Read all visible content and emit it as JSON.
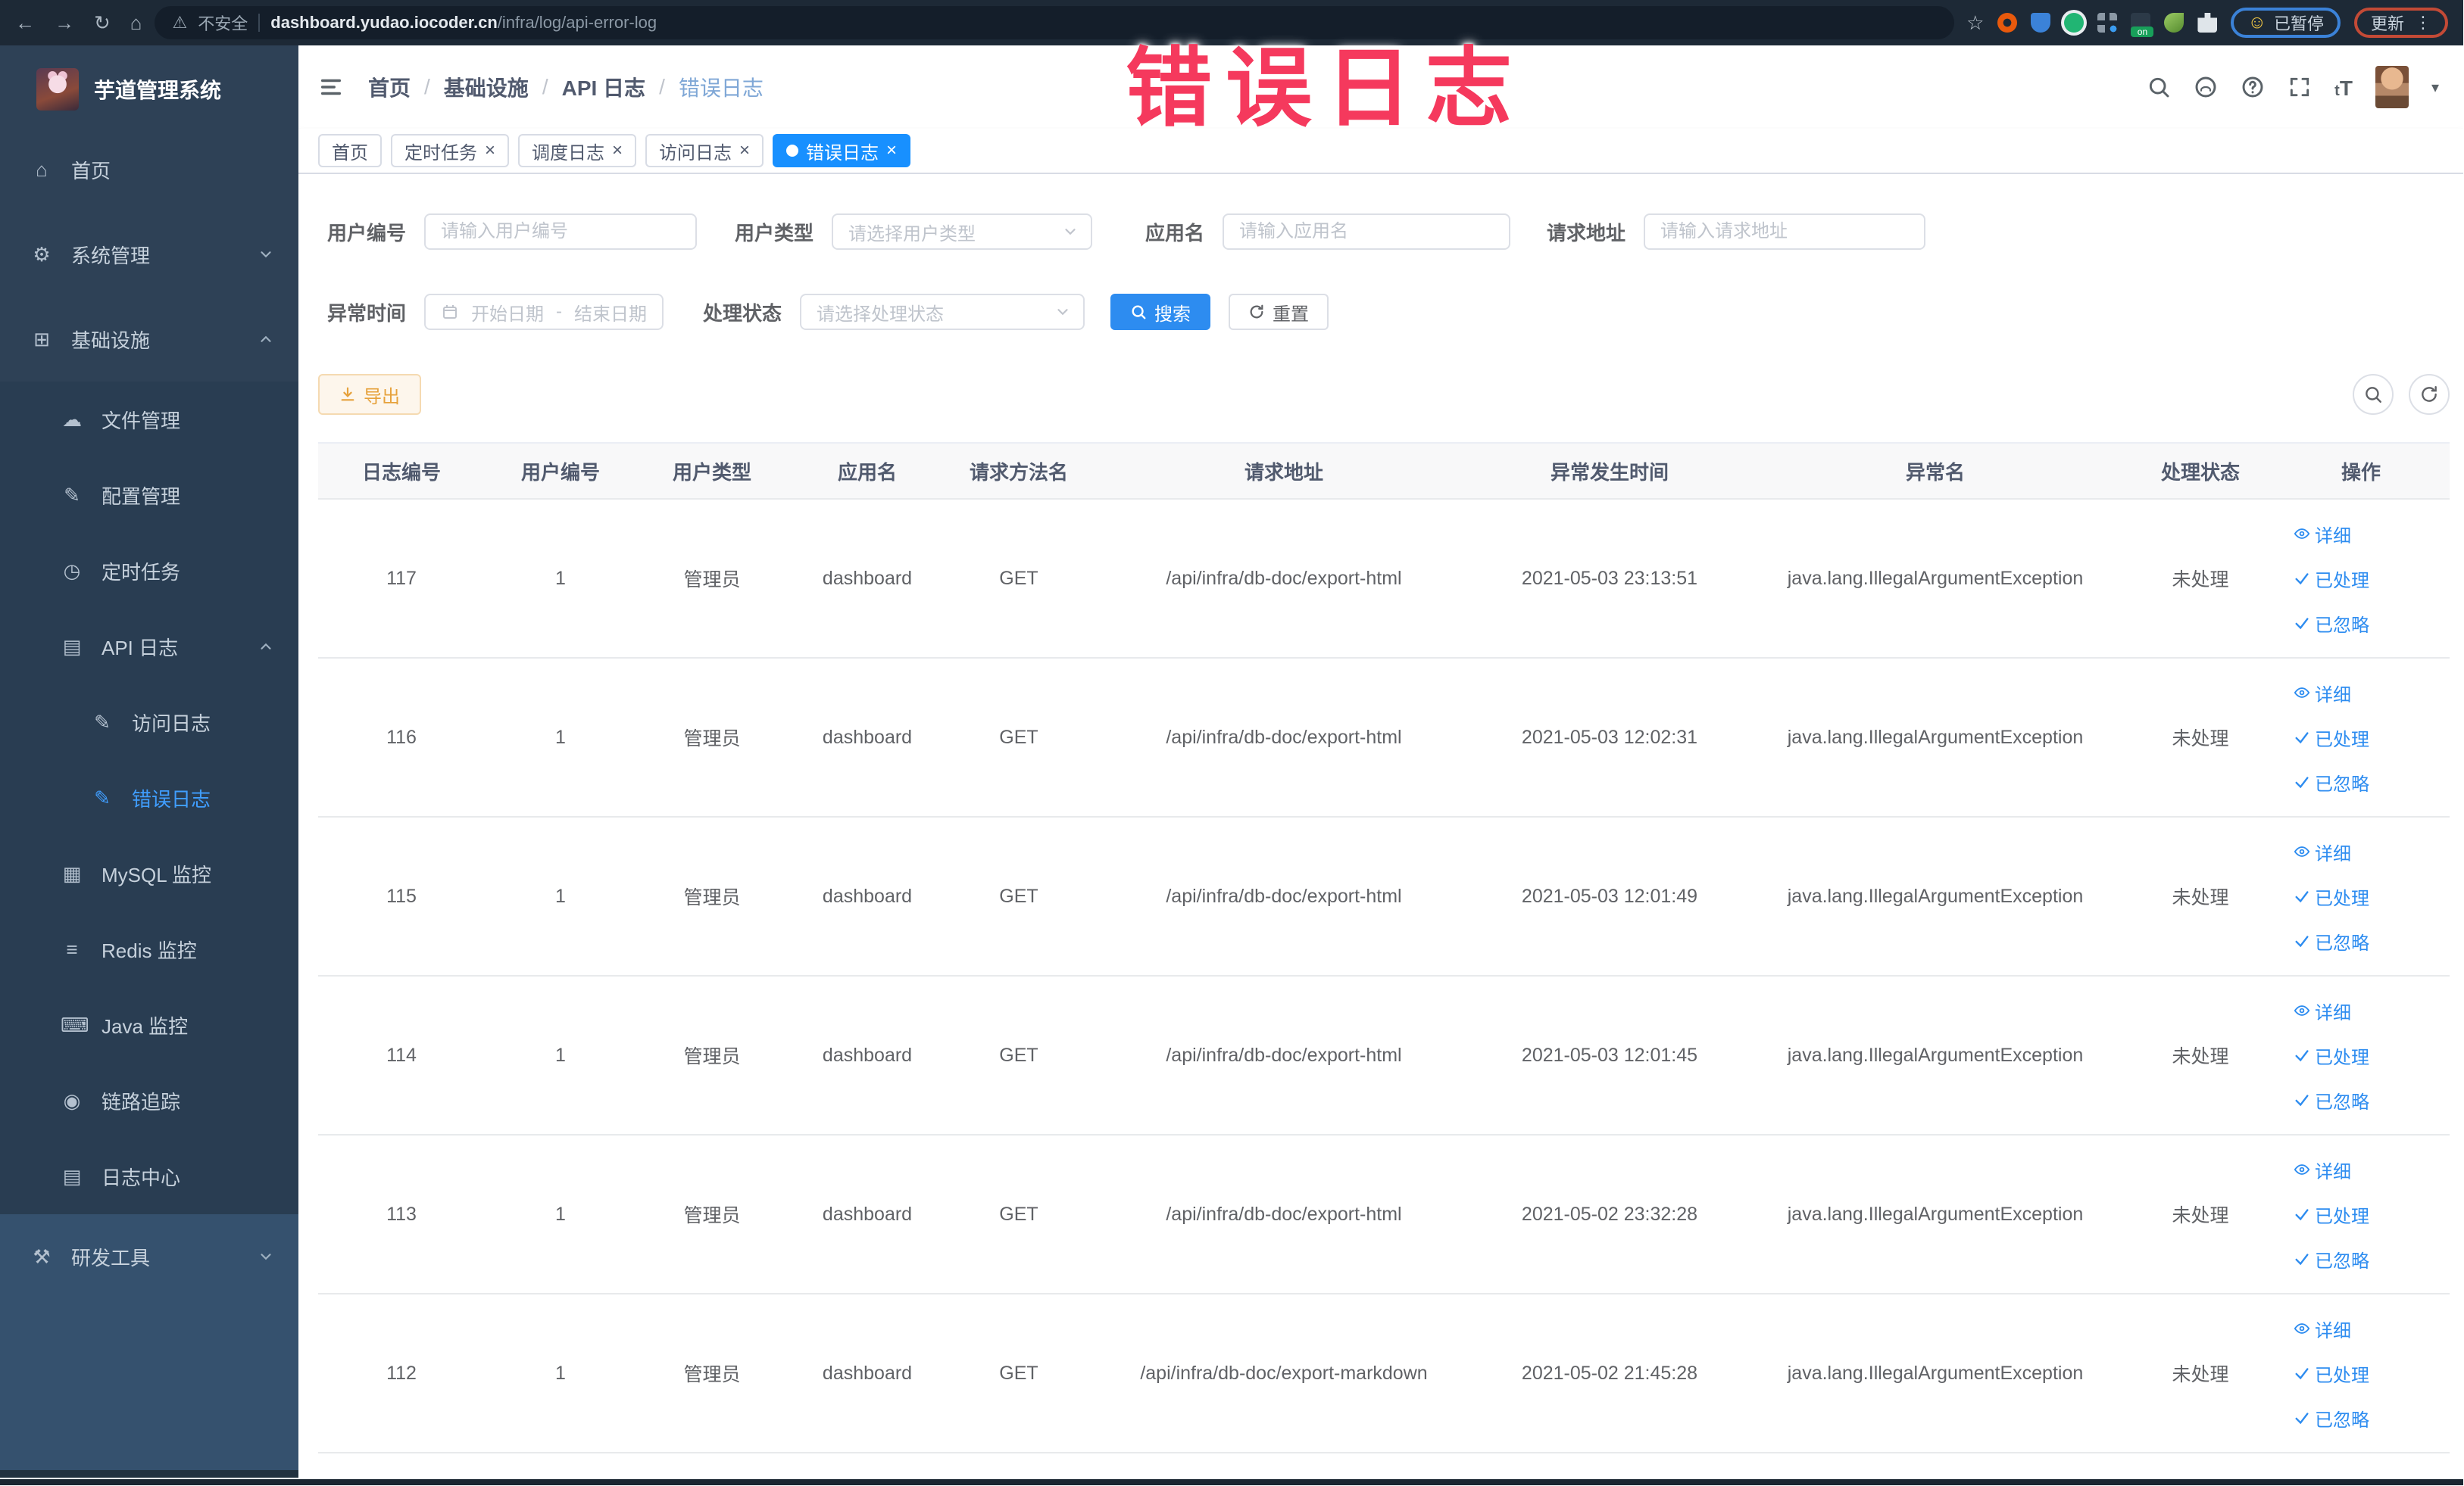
{
  "browser": {
    "security_label": "不安全",
    "url_host": "dashboard.yudao.iocoder.cn",
    "url_path": "/infra/log/api-error-log",
    "on_badge": "on",
    "paused_badge": "已暂停",
    "update_button": "更新"
  },
  "annotation": {
    "text": "错误日志",
    "color": "#f5395d"
  },
  "sidebar": {
    "title": "芋道管理系统",
    "items": [
      {
        "label": "首页",
        "icon": "home-icon",
        "depth": 0,
        "bg": "base",
        "active": false,
        "chevron": ""
      },
      {
        "label": "系统管理",
        "icon": "gear-icon",
        "depth": 0,
        "bg": "base",
        "active": false,
        "chevron": "down"
      },
      {
        "label": "基础设施",
        "icon": "infra-icon",
        "depth": 0,
        "bg": "base",
        "active": false,
        "chevron": "up"
      },
      {
        "label": "文件管理",
        "icon": "cloud-upload-icon",
        "depth": 1,
        "bg": "dark",
        "active": false,
        "chevron": ""
      },
      {
        "label": "配置管理",
        "icon": "edit-icon",
        "depth": 1,
        "bg": "dark",
        "active": false,
        "chevron": ""
      },
      {
        "label": "定时任务",
        "icon": "clock-icon",
        "depth": 1,
        "bg": "dark",
        "active": false,
        "chevron": ""
      },
      {
        "label": "API 日志",
        "icon": "api-log-icon",
        "depth": 1,
        "bg": "dark",
        "active": false,
        "chevron": "up"
      },
      {
        "label": "访问日志",
        "icon": "doc-edit-icon",
        "depth": 2,
        "bg": "dark",
        "active": false,
        "chevron": ""
      },
      {
        "label": "错误日志",
        "icon": "doc-edit-icon",
        "depth": 2,
        "bg": "dark",
        "active": true,
        "chevron": ""
      },
      {
        "label": "MySQL 监控",
        "icon": "mysql-icon",
        "depth": 1,
        "bg": "dark",
        "active": false,
        "chevron": ""
      },
      {
        "label": "Redis 监控",
        "icon": "redis-icon",
        "depth": 1,
        "bg": "dark",
        "active": false,
        "chevron": ""
      },
      {
        "label": "Java 监控",
        "icon": "java-icon",
        "depth": 1,
        "bg": "dark",
        "active": false,
        "chevron": ""
      },
      {
        "label": "链路追踪",
        "icon": "trace-eye-icon",
        "depth": 1,
        "bg": "dark",
        "active": false,
        "chevron": ""
      },
      {
        "label": "日志中心",
        "icon": "log-center-icon",
        "depth": 1,
        "bg": "dark",
        "active": false,
        "chevron": ""
      },
      {
        "label": "研发工具",
        "icon": "tools-icon",
        "depth": 0,
        "bg": "light",
        "active": false,
        "chevron": "down"
      }
    ]
  },
  "breadcrumb": [
    "首页",
    "基础设施",
    "API 日志",
    "错误日志"
  ],
  "tabs": [
    {
      "label": "首页",
      "closable": false,
      "active": false
    },
    {
      "label": "定时任务",
      "closable": true,
      "active": false
    },
    {
      "label": "调度日志",
      "closable": true,
      "active": false
    },
    {
      "label": "访问日志",
      "closable": true,
      "active": false
    },
    {
      "label": "错误日志",
      "closable": true,
      "active": true
    }
  ],
  "filters": {
    "user_id": {
      "label": "用户编号",
      "placeholder": "请输入用户编号"
    },
    "user_type": {
      "label": "用户类型",
      "placeholder": "请选择用户类型"
    },
    "app_name": {
      "label": "应用名",
      "placeholder": "请输入应用名"
    },
    "request_url": {
      "label": "请求地址",
      "placeholder": "请输入请求地址"
    },
    "exception_time": {
      "label": "异常时间",
      "start_placeholder": "开始日期",
      "separator": "-",
      "end_placeholder": "结束日期"
    },
    "process_status": {
      "label": "处理状态",
      "placeholder": "请选择处理状态"
    },
    "search_label": "搜索",
    "reset_label": "重置"
  },
  "toolbar": {
    "export_label": "导出"
  },
  "table": {
    "columns": [
      "日志编号",
      "用户编号",
      "用户类型",
      "应用名",
      "请求方法名",
      "请求地址",
      "异常发生时间",
      "异常名",
      "处理状态",
      "操作"
    ],
    "actions": [
      {
        "name": "detail",
        "icon": "eye-icon",
        "label": "详细"
      },
      {
        "name": "processed",
        "icon": "check-icon",
        "label": "已处理"
      },
      {
        "name": "ignored",
        "icon": "check-icon",
        "label": "已忽略"
      }
    ],
    "rows": [
      {
        "id": "117",
        "user_id": "1",
        "user_type": "管理员",
        "app": "dashboard",
        "method": "GET",
        "url": "/api/infra/db-doc/export-html",
        "time": "2021-05-03 23:13:51",
        "exception": "java.lang.IllegalArgumentException",
        "status": "未处理"
      },
      {
        "id": "116",
        "user_id": "1",
        "user_type": "管理员",
        "app": "dashboard",
        "method": "GET",
        "url": "/api/infra/db-doc/export-html",
        "time": "2021-05-03 12:02:31",
        "exception": "java.lang.IllegalArgumentException",
        "status": "未处理"
      },
      {
        "id": "115",
        "user_id": "1",
        "user_type": "管理员",
        "app": "dashboard",
        "method": "GET",
        "url": "/api/infra/db-doc/export-html",
        "time": "2021-05-03 12:01:49",
        "exception": "java.lang.IllegalArgumentException",
        "status": "未处理"
      },
      {
        "id": "114",
        "user_id": "1",
        "user_type": "管理员",
        "app": "dashboard",
        "method": "GET",
        "url": "/api/infra/db-doc/export-html",
        "time": "2021-05-03 12:01:45",
        "exception": "java.lang.IllegalArgumentException",
        "status": "未处理"
      },
      {
        "id": "113",
        "user_id": "1",
        "user_type": "管理员",
        "app": "dashboard",
        "method": "GET",
        "url": "/api/infra/db-doc/export-html",
        "time": "2021-05-02 23:32:28",
        "exception": "java.lang.IllegalArgumentException",
        "status": "未处理"
      },
      {
        "id": "112",
        "user_id": "1",
        "user_type": "管理员",
        "app": "dashboard",
        "method": "GET",
        "url": "/api/infra/db-doc/export-markdown",
        "time": "2021-05-02 21:45:28",
        "exception": "java.lang.IllegalArgumentException",
        "status": "未处理"
      }
    ]
  },
  "colors": {
    "accent_blue": "#2d8cf0",
    "active_tab": "#1890ff",
    "menu_active": "#409eff",
    "export_orange": "#e6a23c",
    "annotation_red": "#f5395d",
    "sidebar_bg": "#2e4156"
  }
}
